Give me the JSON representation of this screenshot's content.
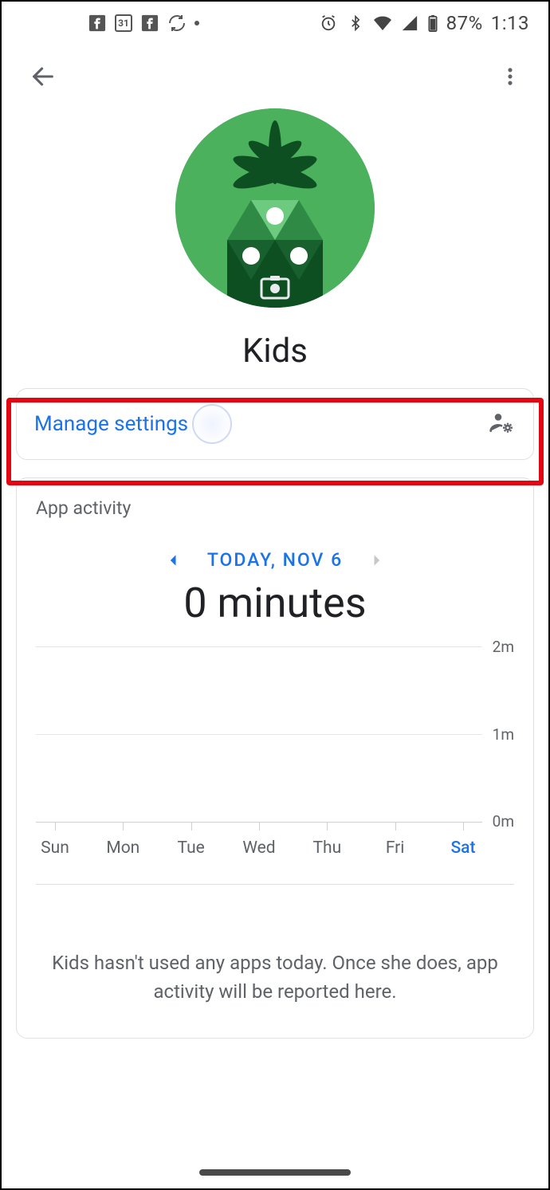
{
  "statusbar": {
    "calendar_day": "31",
    "battery_pct": "87%",
    "clock": "1:13"
  },
  "profile": {
    "name": "Kids"
  },
  "manage": {
    "label": "Manage settings"
  },
  "activity": {
    "title": "App activity",
    "date_label": "TODAY, NOV 6",
    "total": "0 minutes",
    "empty_message": "Kids hasn't used any apps today. Once she does, app activity will be reported here."
  },
  "chart_data": {
    "type": "bar",
    "title": "App activity",
    "xlabel": "",
    "ylabel": "",
    "ylim": [
      0,
      2
    ],
    "y_ticks": [
      "0m",
      "1m",
      "2m"
    ],
    "categories": [
      "Sun",
      "Mon",
      "Tue",
      "Wed",
      "Thu",
      "Fri",
      "Sat"
    ],
    "values": [
      0,
      0,
      0,
      0,
      0,
      0,
      0
    ],
    "active_category_index": 6
  }
}
